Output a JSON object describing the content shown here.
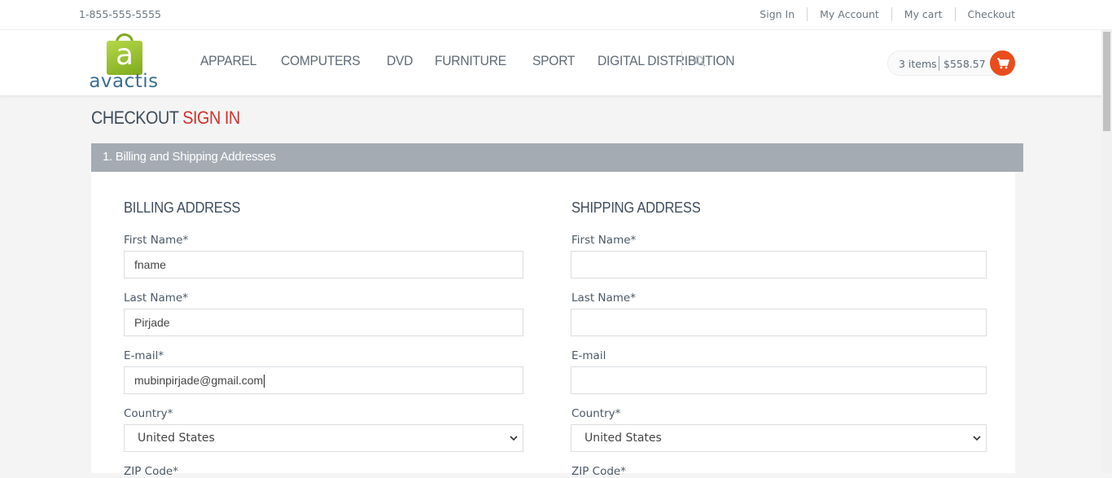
{
  "topbar": {
    "phone": "1-855-555-5555",
    "links": [
      "Sign In",
      "My Account",
      "My cart",
      "Checkout"
    ]
  },
  "brand": {
    "letter": "a",
    "name": "avactis"
  },
  "nav": [
    "APPAREL",
    "COMPUTERS",
    "DVD",
    "FURNITURE",
    "SPORT",
    "DIGITAL DISTRIBUTION"
  ],
  "cart": {
    "items": "3 items",
    "total": "$558.57"
  },
  "page": {
    "title_main": "CHECKOUT",
    "title_accent": "SIGN IN"
  },
  "step": {
    "label": "1. Billing and Shipping Addresses"
  },
  "billing": {
    "title": "BILLING ADDRESS",
    "first_name_label": "First Name*",
    "first_name_value": "fname",
    "last_name_label": "Last Name*",
    "last_name_value": "Pirjade",
    "email_label": "E-mail*",
    "email_value": "mubinpirjade@gmail.com",
    "country_label": "Country*",
    "country_value": "United States",
    "zip_label": "ZIP Code*"
  },
  "shipping": {
    "title": "SHIPPING ADDRESS",
    "first_name_label": "First Name*",
    "first_name_value": "",
    "last_name_label": "Last Name*",
    "last_name_value": "",
    "email_label": "E-mail",
    "email_value": "",
    "country_label": "Country*",
    "country_value": "United States",
    "zip_label": "ZIP Code*"
  },
  "colors": {
    "accent": "#d0322c",
    "cart_button": "#e94d1c",
    "step_bar": "#a4abb3"
  },
  "icons": {
    "search": "search-icon",
    "cart": "shopping-cart-icon",
    "select": "chevron-down-icon"
  }
}
